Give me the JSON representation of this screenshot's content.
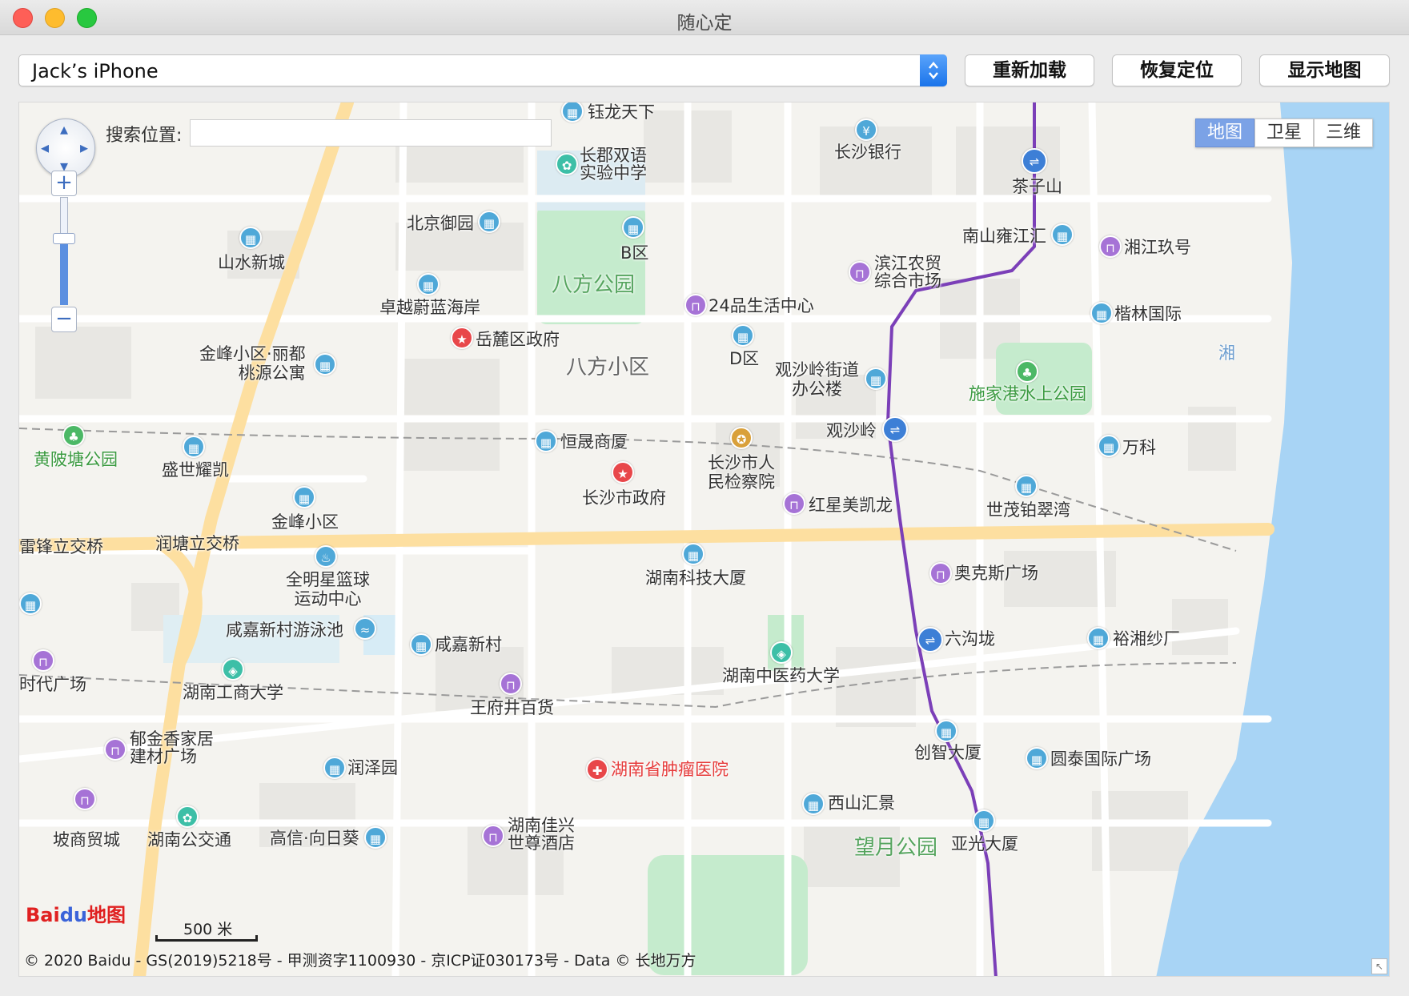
{
  "window": {
    "title": "随心定"
  },
  "toolbar": {
    "device": "Jack’s iPhone",
    "reload": "重新加载",
    "restore": "恢复定位",
    "show_map": "显示地图"
  },
  "map": {
    "search_label": "搜索位置:",
    "search_value": "",
    "map_types": [
      "地图",
      "卫星",
      "三维"
    ],
    "active_type": "地图",
    "zoom_in": "+",
    "zoom_out": "−",
    "scale": "500 米",
    "logo_bai": "Bai",
    "logo_du": "du",
    "logo_map": "地图",
    "copyright": "© 2020 Baidu - GS(2019)5218号 - 甲测资字1100930 - 京ICP证030173号 - Data © 长地万方",
    "labels": {
      "yulong": "钰龙天下",
      "changjun": "长郡双语\n实验中学",
      "ccb": "长沙银行",
      "chazishan": "茶子山",
      "beijing": "北京御园",
      "bqu": "B区",
      "shanshui": "山水新城",
      "nanshan": "南山雍江汇",
      "xiangjiang": "湘江玖号",
      "binjiang": "滨江农贸\n综合市场",
      "bafang_park": "八方公园",
      "24pin": "24品生活中心",
      "zhuoyue": "卓越蔚蓝海岸",
      "kailin": "楷林国际",
      "yuelu": "岳麓区政府",
      "dqu": "D区",
      "jinfeng_li": "金峰小区·丽都\n桃源公寓",
      "bafang": "八方小区",
      "guanshaling_st": "观沙岭街道\n办公楼",
      "shijiagang": "施家港水上公园",
      "river": "湘",
      "guanshaling": "观沙岭",
      "wanke": "万科",
      "huangpitang": "黄陂塘公园",
      "hengsheng": "恒晟商厦",
      "shengshi": "盛世耀凯",
      "jiancha": "长沙市人\n民检察院",
      "shizhengfu": "长沙市政府",
      "hongxing": "红星美凯龙",
      "shimao": "世茂铂翠湾",
      "jinfeng": "金峰小区",
      "leifeng": "雷锋立交桥",
      "runtang": "润塘立交桥",
      "quanmingxing": "全明星篮球\n运动中心",
      "hnkeji": "湖南科技大厦",
      "aokesi": "奥克斯广场",
      "xianjia_pool": "咸嘉新村游泳池",
      "liugoulong": "六沟垅",
      "yuxiang": "裕湘纱厂",
      "xianjia": "咸嘉新村",
      "hnzhongyi": "湖南中医药大学",
      "shidai": "时代广场",
      "hngongshang": "湖南工商大学",
      "wangfujing": "王府井百货",
      "yujin": "郁金香家居\n建材广场",
      "chuangzhi": "创智大厦",
      "yuantai": "圆泰国际广场",
      "runze": "润泽园",
      "zhongliu": "湖南省肿瘤医院",
      "xishan": "西山汇景",
      "gaoxin": "高信·向日葵",
      "jiaxing": "湖南佳兴\n世尊酒店",
      "wangyue": "望月公园",
      "yaguang": "亚光大厦",
      "gucheng": "坡商贸城",
      "hnchuan": "湖南公交通"
    }
  },
  "colors": {
    "metro_line": "#7b3fb8",
    "main_road": "#fddfa0",
    "water": "#a8d4f5",
    "park": "#c5ebcd",
    "accent": "#1a74ea"
  }
}
